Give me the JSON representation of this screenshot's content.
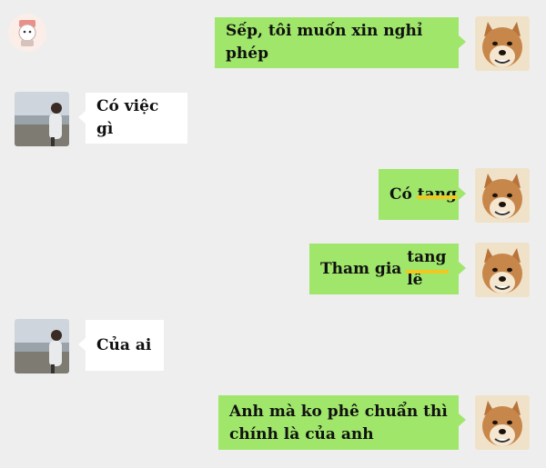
{
  "logo": {
    "icon": "cartoon-character-logo-icon"
  },
  "messages": [
    {
      "sender": "me",
      "avatar": "shiba-dog-avatar-icon",
      "parts": [
        {
          "text": "Sếp, tôi muốn xin nghỉ phép",
          "strike": false
        }
      ]
    },
    {
      "sender": "other",
      "avatar": "man-lakeside-avatar-icon",
      "parts": [
        {
          "text": "Có việc gì",
          "strike": false
        }
      ]
    },
    {
      "sender": "me",
      "avatar": "shiba-dog-avatar-icon",
      "parts": [
        {
          "text": "Có ",
          "strike": false
        },
        {
          "text": "tang",
          "strike": true
        }
      ]
    },
    {
      "sender": "me",
      "avatar": "shiba-dog-avatar-icon",
      "parts": [
        {
          "text": "Tham gia ",
          "strike": false
        },
        {
          "text": "tang lễ",
          "strike": true
        }
      ]
    },
    {
      "sender": "other",
      "avatar": "man-lakeside-avatar-icon",
      "parts": [
        {
          "text": "Của ai",
          "strike": false
        }
      ]
    },
    {
      "sender": "me",
      "avatar": "shiba-dog-avatar-icon",
      "lines": [
        "Anh mà ko phê chuẩn thì",
        "chính là của anh"
      ]
    }
  ]
}
